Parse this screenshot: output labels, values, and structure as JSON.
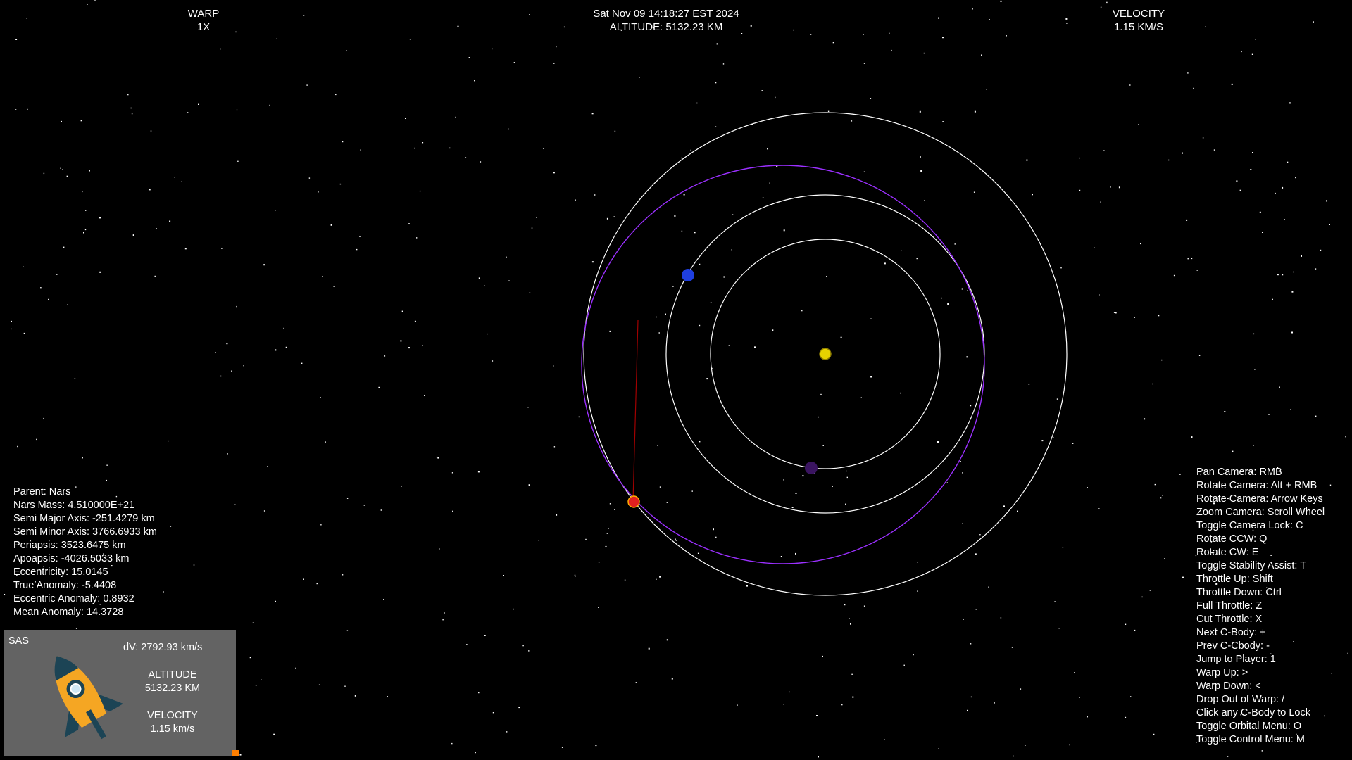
{
  "hud": {
    "warp_label": "WARP",
    "warp_value": "1X",
    "datetime": "Sat Nov 09 14:18:27 EST 2024",
    "altitude": "ALTITUDE: 5132.23 KM",
    "velocity_label": "VELOCITY",
    "velocity_value": "1.15 KM/S"
  },
  "orbit_info": [
    "Parent: Nars",
    "Nars Mass: 4.510000E+21",
    "Semi Major Axis: -251.4279 km",
    "Semi Minor Axis: 3766.6933 km",
    "Periapsis: 3523.6475 km",
    "Apoapsis: -4026.5033 km",
    "Eccentricity: 15.0145",
    "True Anomaly: -5.4408",
    "Eccentric Anomaly: 0.8932",
    "Mean Anomaly: 14.3728"
  ],
  "controls": [
    "Pan Camera: RMB",
    "Rotate Camera: Alt + RMB",
    "Rotate Camera: Arrow Keys",
    "Zoom Camera: Scroll Wheel",
    "Toggle Camera Lock: C",
    "Rotate CCW: Q",
    "Rotate  CW: E",
    "Toggle Stability Assist: T",
    "Throttle Up: Shift",
    "Throttle Down: Ctrl",
    "Full Throttle: Z",
    "Cut Throttle: X",
    "Next C-Body:  +",
    "Prev C-Cbody: -",
    "Jump to Player: 1",
    "Warp Up: >",
    "Warp Down: <",
    "Drop Out of Warp: /",
    "Click any C-Body to Lock",
    "Toggle Orbital Menu: O",
    "Toggle Control Menu: M"
  ],
  "panel": {
    "sas_label": "SAS",
    "dv": "dV: 2792.93 km/s",
    "altitude_label": "ALTITUDE",
    "altitude_value": "5132.23 KM",
    "velocity_label": "VELOCITY",
    "velocity_value": "1.15 km/s",
    "throttle_color": "#ff7f00"
  },
  "colors": {
    "background": "#000000",
    "orbit_ring": "#ffffff",
    "ship_orbit": "#9b30ff",
    "sun": "#e6d200",
    "blue_planet": "#1f3fe0",
    "purple_planet": "#3a1460",
    "ship": "#e02020",
    "trajectory": "#a00000"
  },
  "icons": [
    "rocket-icon",
    "star-field"
  ]
}
